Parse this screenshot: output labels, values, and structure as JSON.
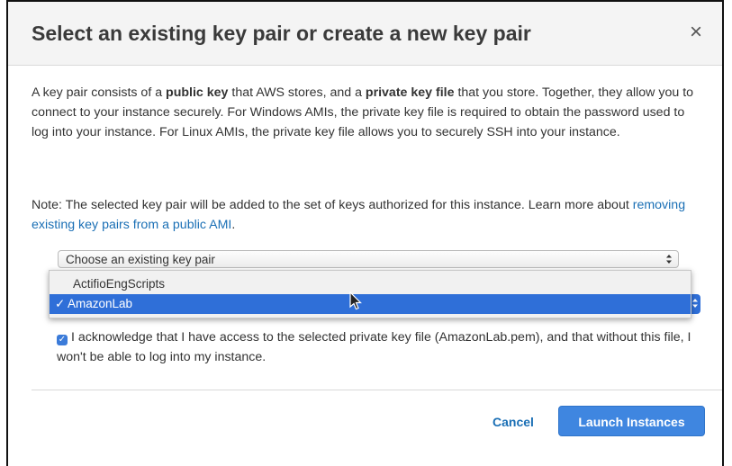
{
  "dialog": {
    "title": "Select an existing key pair or create a new key pair",
    "close_symbol": "×"
  },
  "intro": {
    "t1": "A key pair consists of a ",
    "b1": "public key",
    "t2": " that AWS stores, and a ",
    "b2": "private key file",
    "t3": " that you store. Together, they allow you to connect to your instance securely. For Windows AMIs, the private key file is required to obtain the password used to log into your instance. For Linux AMIs, the private key file allows you to securely SSH into your instance."
  },
  "note": {
    "text": "Note: The selected key pair will be added to the set of keys authorized for this instance. Learn more about ",
    "link": "removing existing key pairs from a public AMI",
    "suffix": "."
  },
  "key_pair_type_select": {
    "value": "Choose an existing key pair"
  },
  "key_pair_dropdown": {
    "options": [
      "ActifioEngScripts",
      "AmazonLab"
    ],
    "selected": "AmazonLab",
    "check_mark": "✓"
  },
  "acknowledge": {
    "checked": true,
    "check_mark": "✓",
    "text": "I acknowledge that I have access to the selected private key file (AmazonLab.pem), and that without this file, I won't be able to log into my instance."
  },
  "footer": {
    "cancel_label": "Cancel",
    "launch_label": "Launch Instances"
  },
  "colors": {
    "link": "#1a6fb5",
    "selection": "#2f6fd8",
    "primary_button": "#3f86e0",
    "header_bg": "#f4f4f4"
  },
  "icons": {
    "close": "close-icon",
    "select_arrows": "up-down-arrows-icon",
    "cursor": "mouse-pointer-icon",
    "check": "check-icon"
  }
}
